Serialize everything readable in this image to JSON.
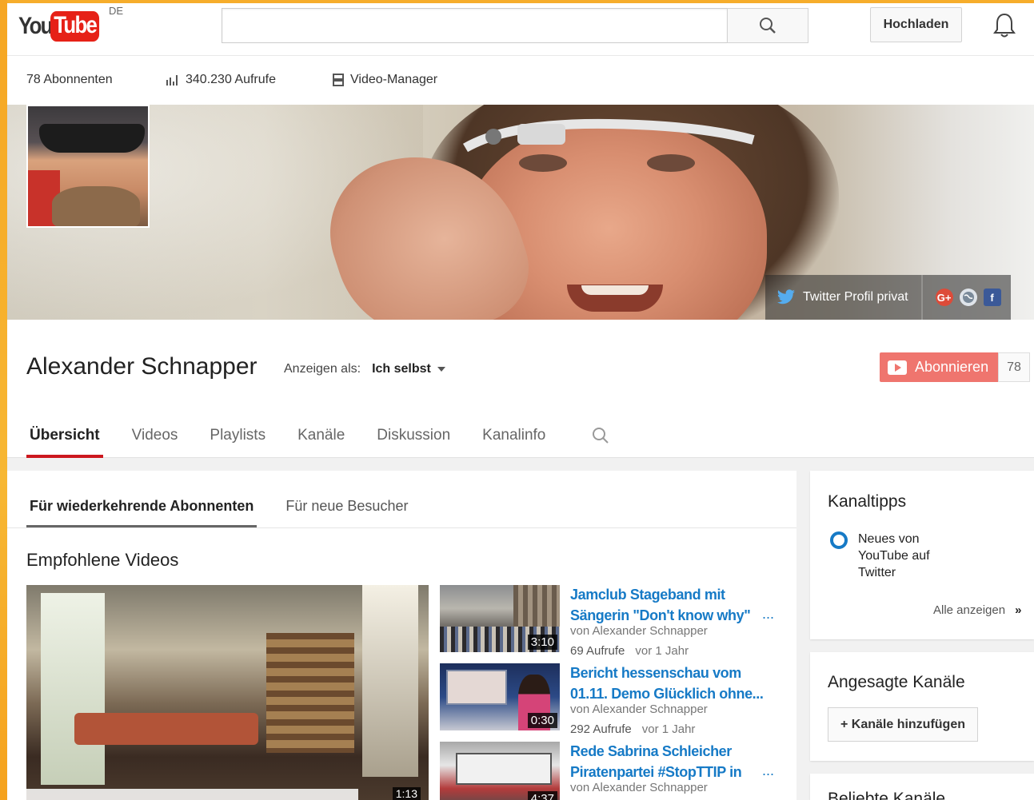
{
  "masthead": {
    "logo_you": "You",
    "logo_tube": "Tube",
    "region": "DE",
    "search_placeholder": "",
    "upload_label": "Hochladen"
  },
  "stats": {
    "subscribers": "78 Abonnenten",
    "views": "340.230 Aufrufe",
    "video_manager": "Video-Manager"
  },
  "banner": {
    "twitter_label": "Twitter Profil privat",
    "social_icons": [
      "google-plus-icon",
      "globe-icon",
      "facebook-icon"
    ],
    "gplus_glyph": "G+",
    "facebook_glyph": "f"
  },
  "channel": {
    "title": "Alexander Schnapper",
    "view_as_label": "Anzeigen als:",
    "view_as_value": "Ich selbst",
    "subscribe_label": "Abonnieren",
    "subscribe_count": "78",
    "accent": "#cc181e"
  },
  "tabs": [
    {
      "label": "Übersicht"
    },
    {
      "label": "Videos"
    },
    {
      "label": "Playlists"
    },
    {
      "label": "Kanäle"
    },
    {
      "label": "Diskussion"
    },
    {
      "label": "Kanalinfo"
    }
  ],
  "main": {
    "subtabs": [
      {
        "label": "Für wiederkehrende Abonnenten"
      },
      {
        "label": "Für neue Besucher"
      }
    ],
    "section_title": "Empfohlene Videos",
    "featured_duration": "1:13",
    "videos": [
      {
        "title_line1": "Jamclub Stageband mit",
        "title_line2": "Sängerin \"Don't know why\"",
        "more": "...",
        "by": "von Alexander Schnapper",
        "views": "69 Aufrufe",
        "age": "vor 1 Jahr",
        "duration": "3:10"
      },
      {
        "title_line1": "Bericht hessenschau vom",
        "title_line2": "01.11. Demo Glücklich ohne...",
        "more": "",
        "by": "von Alexander Schnapper",
        "views": "292 Aufrufe",
        "age": "vor 1 Jahr",
        "duration": "0:30"
      },
      {
        "title_line1": "Rede Sabrina Schleicher",
        "title_line2": "Piratenpartei #StopTTIP in",
        "more": "...",
        "by": "von Alexander Schnapper",
        "views": "",
        "age": "",
        "duration": "4:37"
      }
    ]
  },
  "sidebar": {
    "tips_title": "Kanaltipps",
    "tip_text": "Neues von YouTube auf Twitter",
    "see_all": "Alle anzeigen",
    "see_all_chevron": "»",
    "featured_title": "Angesagte Kanäle",
    "add_channels": "+ Kanäle hinzufügen",
    "popular_title": "Beliebte Kanäle"
  }
}
